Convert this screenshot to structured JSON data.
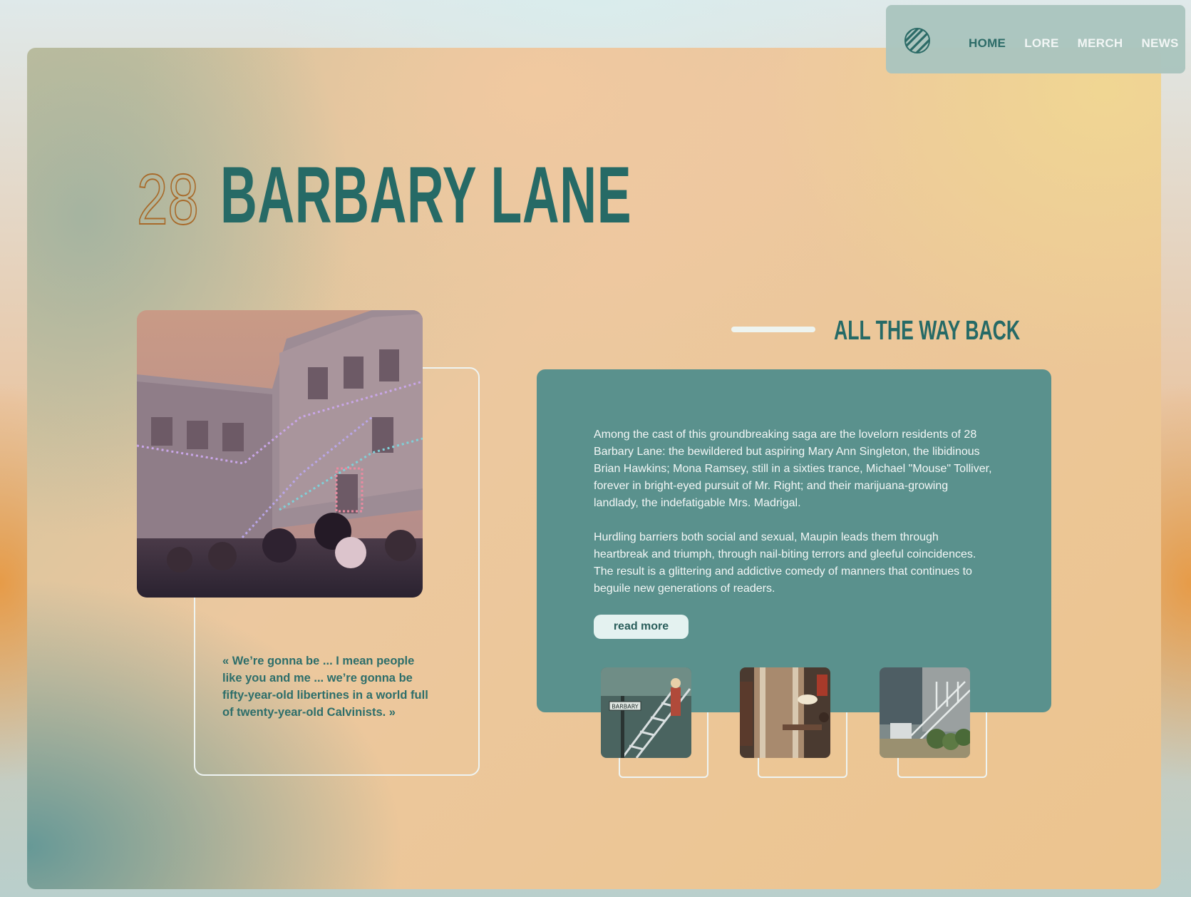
{
  "nav": {
    "links": [
      "HOME",
      "LORE",
      "MERCH",
      "NEWS"
    ],
    "active": "HOME",
    "logo_icon": "striped-circle-logo-icon"
  },
  "hero": {
    "number": "28",
    "title": "BARBARY LANE"
  },
  "quote": {
    "text": "« We’re gonna be ... I mean people like you and me ... we’re gonna be fifty-year-old libertines in a world full of twenty-year-old Calvinists. »"
  },
  "section": {
    "heading": "ALL THE WAY BACK",
    "paragraph1": "Among the cast of this groundbreaking saga are the lovelorn residents of 28 Barbary Lane: the bewildered but aspiring Mary Ann Singleton, the libidinous Brian Hawkins; Mona Ramsey, still in a sixties trance, Michael \"Mouse\" Tolliver, forever in bright-eyed pursuit of Mr. Right; and their marijuana-growing landlady, the indefatigable Mrs. Madrigal.",
    "paragraph2": "Hurdling barriers both social and sexual, Maupin leads them through heartbreak and triumph, through nail-biting terrors and gleeful coincidences. The result is a glittering and addictive comedy of manners that continues to beguile new generations of readers.",
    "read_more": "read more"
  },
  "thumbnail_sign_text": "BARBARY",
  "colors": {
    "teal_dark": "#266a66",
    "teal_panel": "#5a918d",
    "outline_orange": "#a86a2a",
    "nav_bg": "#aac4be"
  }
}
